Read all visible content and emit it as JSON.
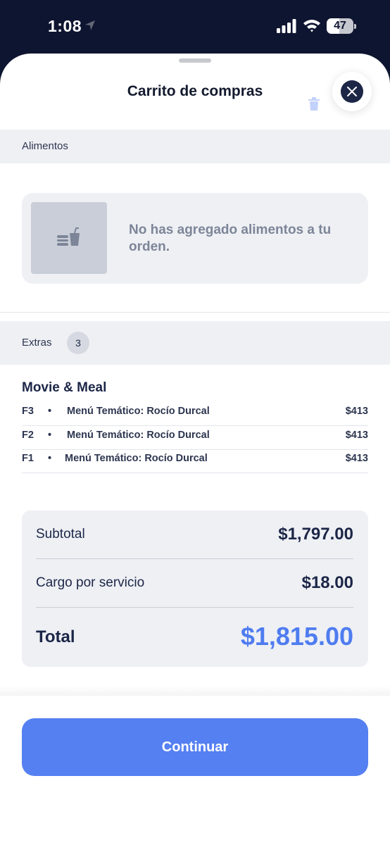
{
  "status_bar": {
    "time": "1:08",
    "battery": "47",
    "battery_level": 0.47
  },
  "sheet": {
    "title": "Carrito de compras"
  },
  "sections": {
    "foods_label": "Alimentos",
    "extras_label": "Extras",
    "extras_count": "3"
  },
  "foods_empty": {
    "message": "No has agregado alimentos a tu orden."
  },
  "combo": {
    "title": "Movie & Meal",
    "items": [
      {
        "seat": "F3",
        "dot": "•",
        "name": "Menú Temático: Rocío Durcal",
        "price": "$413"
      },
      {
        "seat": "F2",
        "dot": "•",
        "name": "Menú Temático: Rocío Durcal",
        "price": "$413"
      },
      {
        "seat": "F1",
        "dot": "•",
        "name": "Menú Temático: Rocío Durcal",
        "price": "$413"
      }
    ]
  },
  "totals": {
    "subtotal_label": "Subtotal",
    "subtotal_value": "$1,797.00",
    "service_label": "Cargo por servicio",
    "service_value": "$18.00",
    "total_label": "Total",
    "total_value": "$1,815.00"
  },
  "footer": {
    "continue_label": "Continuar"
  },
  "colors": {
    "accent": "#5580f2",
    "total_highlight": "#4f7cf0",
    "navy": "#1c2647",
    "panel": "#eef0f4"
  },
  "icons": [
    "location-arrow-icon",
    "signal-icon",
    "wifi-icon",
    "battery-icon",
    "close-icon",
    "trash-icon",
    "food-drink-icon"
  ]
}
